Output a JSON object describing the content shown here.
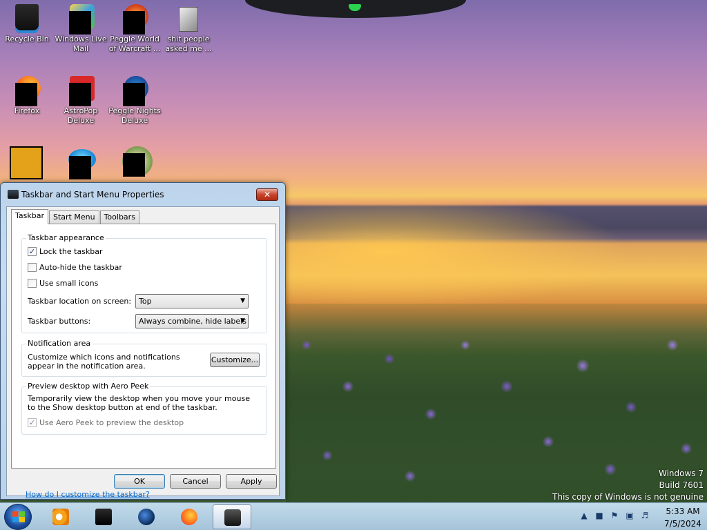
{
  "desktop": {
    "icons": [
      {
        "label": "Recycle Bin"
      },
      {
        "label": "Windows Live\nMail"
      },
      {
        "label": "Peggle World\nof Warcraft ..."
      },
      {
        "label": "shit people\nasked me ..."
      },
      {
        "label": "Firefox"
      },
      {
        "label": "AstroPop\nDeluxe"
      },
      {
        "label": "Peggle Nights\nDeluxe"
      }
    ],
    "watermark": {
      "line1": "Windows 7",
      "line2": "Build 7601",
      "line3": "This copy of Windows is not genuine"
    }
  },
  "dialog": {
    "title": "Taskbar and Start Menu Properties",
    "close_glyph": "✕",
    "tabs": [
      {
        "label": "Taskbar",
        "active": true
      },
      {
        "label": "Start Menu",
        "active": false
      },
      {
        "label": "Toolbars",
        "active": false
      }
    ],
    "appearance": {
      "label": "Taskbar appearance",
      "lock": {
        "label": "Lock the taskbar",
        "checked": true
      },
      "autohide": {
        "label": "Auto-hide the taskbar",
        "checked": false
      },
      "small_icons": {
        "label": "Use small icons",
        "checked": false
      },
      "location": {
        "label": "Taskbar location on screen:",
        "value": "Top"
      },
      "buttons": {
        "label": "Taskbar buttons:",
        "value": "Always combine, hide labels"
      }
    },
    "notification": {
      "label": "Notification area",
      "text": "Customize which icons and notifications appear in the notification area.",
      "button": "Customize..."
    },
    "aero_peek": {
      "label": "Preview desktop with Aero Peek",
      "text": "Temporarily view the desktop when you move your mouse to the Show desktop button at end of the taskbar.",
      "checkbox": {
        "label": "Use Aero Peek to preview the desktop",
        "checked": true,
        "disabled": true
      }
    },
    "help_link": "How do I customize the taskbar?",
    "buttons": {
      "ok": "OK",
      "cancel": "Cancel",
      "apply": "Apply"
    }
  },
  "taskbar": {
    "items": [
      {
        "icon": "start-orb-icon"
      },
      {
        "icon": "media-player-icon"
      },
      {
        "icon": "black-app-icon"
      },
      {
        "icon": "globe-icon"
      },
      {
        "icon": "firefox-icon"
      },
      {
        "icon": "taskbar-properties-icon",
        "active": true
      }
    ],
    "tray": {
      "chevron": "▲",
      "icons": [
        "network-icon",
        "action-center-icon",
        "display-icon",
        "volume-icon"
      ]
    },
    "clock": {
      "time": "5:33 AM",
      "date": "7/5/2024"
    }
  }
}
